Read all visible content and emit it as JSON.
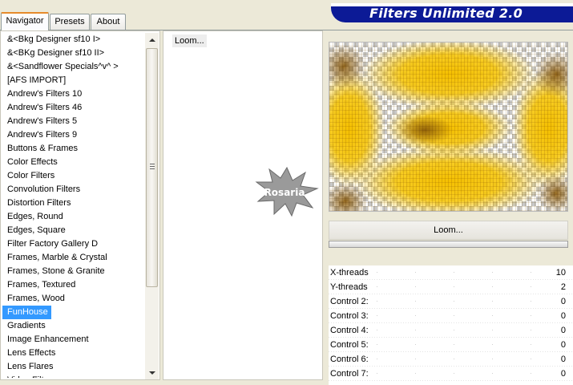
{
  "tabs": [
    {
      "label": "Navigator",
      "active": true
    },
    {
      "label": "Presets",
      "active": false
    },
    {
      "label": "About",
      "active": false
    }
  ],
  "banner": {
    "title": "Filters Unlimited 2.0"
  },
  "categories": {
    "items": [
      "&<Bkg Designer sf10 I>",
      "&<BKg Designer sf10 II>",
      "&<Sandflower Specials^v^ >",
      "[AFS IMPORT]",
      "Andrew's Filters 10",
      "Andrew's Filters 46",
      "Andrew's Filters 5",
      "Andrew's Filters 9",
      "Buttons & Frames",
      "Color Effects",
      "Color Filters",
      "Convolution Filters",
      "Distortion Filters",
      "Edges, Round",
      "Edges, Square",
      "Filter Factory Gallery D",
      "Frames, Marble & Crystal",
      "Frames, Stone & Granite",
      "Frames, Textured",
      "Frames, Wood",
      "FunHouse",
      "Gradients",
      "Image Enhancement",
      "Lens Effects",
      "Lens Flares",
      "Video Filters"
    ],
    "selected": "FunHouse"
  },
  "filters": {
    "items": [
      "Loom..."
    ]
  },
  "watermark": {
    "text": "Rosaria"
  },
  "selected_filter": {
    "label": "Loom..."
  },
  "progress": {
    "value": 0
  },
  "controls": [
    {
      "label": "X-threads",
      "value": "10"
    },
    {
      "label": "Y-threads",
      "value": "2"
    },
    {
      "label": "Control 2:",
      "value": "0"
    },
    {
      "label": "Control 3:",
      "value": "0"
    },
    {
      "label": "Control 4:",
      "value": "0"
    },
    {
      "label": "Control 5:",
      "value": "0"
    },
    {
      "label": "Control 6:",
      "value": "0"
    },
    {
      "label": "Control 7:",
      "value": "0"
    }
  ],
  "colors": {
    "banner": "#0c1a96",
    "selection": "#3399ff",
    "preview_gold": "#f2b807"
  }
}
